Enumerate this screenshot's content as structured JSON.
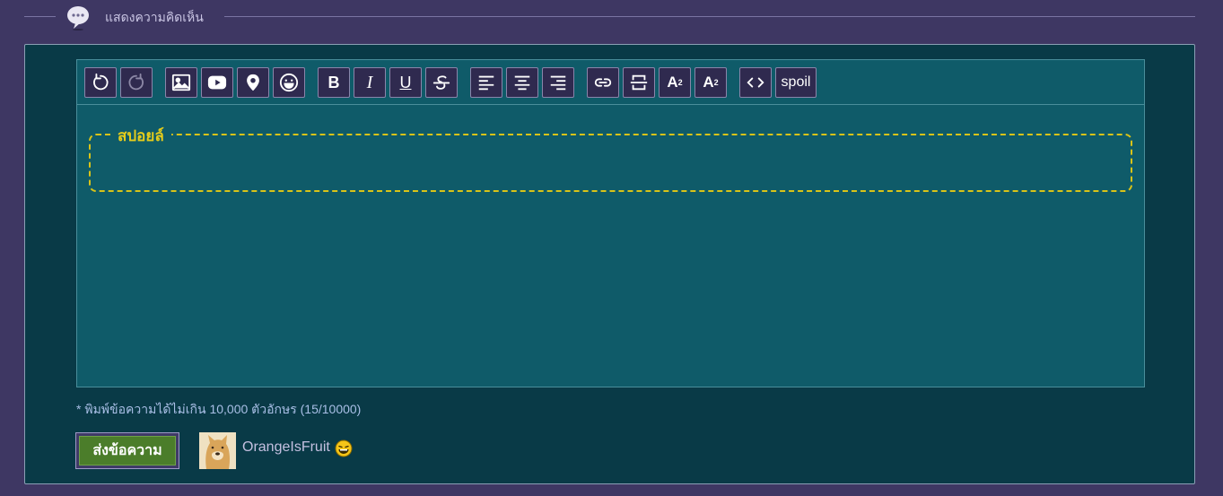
{
  "header": {
    "title": "แสดงความคิดเห็น",
    "icon": "speech-bubble-icon"
  },
  "toolbar": {
    "buttons": [
      {
        "name": "undo",
        "icon": "undo-icon",
        "enabled": true
      },
      {
        "name": "redo",
        "icon": "redo-icon",
        "enabled": false
      },
      {
        "name": "image",
        "icon": "image-icon"
      },
      {
        "name": "youtube",
        "icon": "youtube-icon"
      },
      {
        "name": "location",
        "icon": "location-pin-icon"
      },
      {
        "name": "emoji",
        "icon": "emoji-icon"
      },
      {
        "name": "bold",
        "label": "B"
      },
      {
        "name": "italic",
        "label": "I"
      },
      {
        "name": "underline",
        "label": "U"
      },
      {
        "name": "strikethrough",
        "label": "S"
      },
      {
        "name": "align-left",
        "icon": "align-left-icon"
      },
      {
        "name": "align-center",
        "icon": "align-center-icon"
      },
      {
        "name": "align-right",
        "icon": "align-right-icon"
      },
      {
        "name": "link",
        "icon": "link-icon"
      },
      {
        "name": "page-break",
        "icon": "page-break-icon"
      },
      {
        "name": "superscript",
        "label": "A",
        "mark": "2"
      },
      {
        "name": "subscript",
        "label": "A",
        "mark": "2"
      },
      {
        "name": "code",
        "icon": "code-icon"
      },
      {
        "name": "spoiler",
        "label": "spoil"
      }
    ]
  },
  "editor": {
    "spoiler_label": "สปอยล์"
  },
  "limit_note": "* พิมพ์ข้อความได้ไม่เกิน 10,000 ตัวอักษร (15/10000)",
  "send_button": {
    "label": "ส่งข้อความ"
  },
  "user": {
    "name": "OrangeIsFruit",
    "avatar": "doge-avatar",
    "status_icon": "laughing-emoji-icon"
  },
  "colors": {
    "page_bg": "#3e3763",
    "panel_bg": "#093a47",
    "editor_bg": "#0f5b69",
    "spoiler_accent": "#e5cc1b",
    "send_green": "#4b7d2a"
  }
}
